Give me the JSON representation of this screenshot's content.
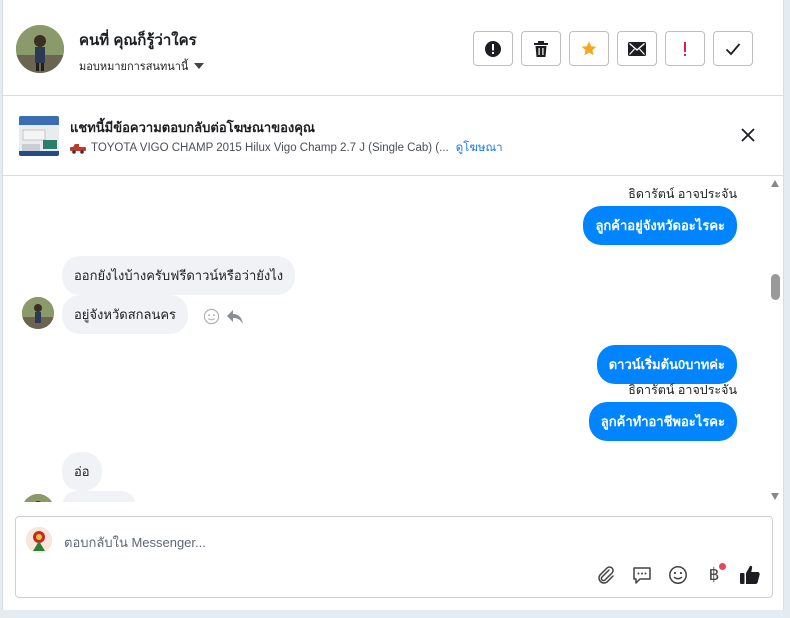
{
  "header": {
    "name": "คนที่ คุณก็รู้ว่าใคร",
    "assign_label": "มอบหมายการสนทนานี้"
  },
  "actions": [
    {
      "name": "spam-button",
      "icon": "alert-icon"
    },
    {
      "name": "delete-button",
      "icon": "trash-icon"
    },
    {
      "name": "star-button",
      "icon": "star-icon"
    },
    {
      "name": "mark-unread-button",
      "icon": "envelope-icon"
    },
    {
      "name": "follow-up-button",
      "icon": "exclamation-icon"
    },
    {
      "name": "done-button",
      "icon": "check-icon"
    }
  ],
  "ad": {
    "title": "แชทนี้มีข้อความตอบกลับต่อโฆษณาของคุณ",
    "subtitle": "TOYOTA VIGO CHAMP 2015 Hilux Vigo Champ 2.7 J (Single Cab) (...",
    "link": "ดูโฆษณา"
  },
  "messages": {
    "m1_sender": "ธิดารัตน์ อาจประจัน",
    "m1_text": "ลูกค้าอยู่จังหวัดอะไรคะ",
    "m2_text": "ออกยังไงบ้างครับฟรีดาวน์หรือว่ายังไง",
    "m3_text": "อยู่จังหวัดสกลนคร",
    "m4_text": "ดาวน์เริ่มต้น0บาทค่ะ",
    "m5_sender": "ธิดารัตน์ อาจประจัน",
    "m5_text": "ลูกค้าทำอาชีพอะไรคะ",
    "m6_text": "อ่อ"
  },
  "composer": {
    "placeholder": "ตอบกลับใน Messenger..."
  },
  "colors": {
    "outgoing_bubble": "#0084ff",
    "incoming_bubble": "#f0f2f5",
    "star": "#f5a623",
    "follow_up": "#e41e3f",
    "link": "#1877f2"
  }
}
